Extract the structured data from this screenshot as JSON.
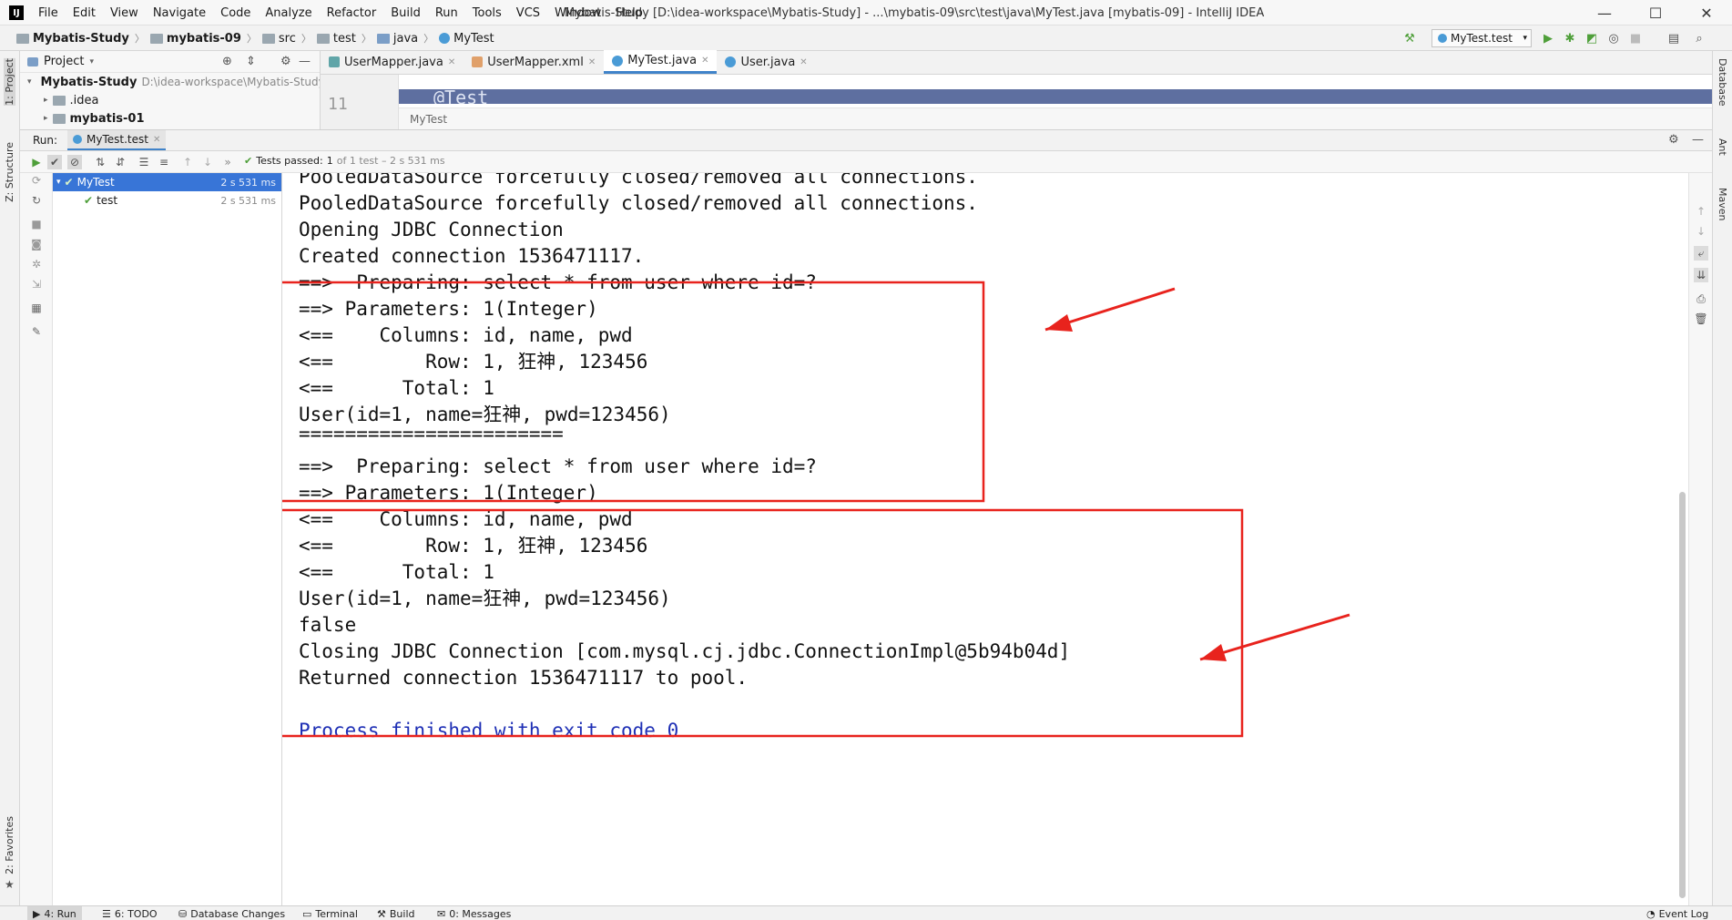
{
  "title_bar": {
    "app_icon": "IJ",
    "menu": [
      "File",
      "Edit",
      "View",
      "Navigate",
      "Code",
      "Analyze",
      "Refactor",
      "Build",
      "Run",
      "Tools",
      "VCS",
      "Window",
      "Help"
    ],
    "window_title": "Mybatis-Study [D:\\idea-workspace\\Mybatis-Study] - ...\\mybatis-09\\src\\test\\java\\MyTest.java [mybatis-09] - IntelliJ IDEA",
    "minimize": "—",
    "maximize": "☐",
    "close": "✕"
  },
  "navbar": {
    "crumbs": [
      "Mybatis-Study",
      "mybatis-09",
      "src",
      "test",
      "java",
      "MyTest"
    ],
    "run_config": "MyTest.test"
  },
  "left_stripe": {
    "project_label": "1: Project",
    "structure_label": "Z: Structure",
    "favorites_label": "2: Favorites"
  },
  "right_stripe": {
    "database_label": "Database",
    "ant_label": "Ant",
    "maven_label": "Maven"
  },
  "project_panel": {
    "title": "Project",
    "root": "Mybatis-Study",
    "root_path": "D:\\idea-workspace\\Mybatis-Study",
    "items": [
      ".idea",
      "mybatis-01"
    ]
  },
  "editor": {
    "tabs": [
      {
        "label": "UserMapper.java",
        "active": false
      },
      {
        "label": "UserMapper.xml",
        "active": false
      },
      {
        "label": "MyTest.java",
        "active": true
      },
      {
        "label": "User.java",
        "active": false
      }
    ],
    "line_number": "11",
    "code": "@Test",
    "breadcrumb": "MyTest"
  },
  "run_window": {
    "label": "Run:",
    "tab": "MyTest.test",
    "status": "Tests passed:",
    "status_count": "1",
    "status_detail": "of 1 test – 2 s 531 ms",
    "tree": [
      {
        "label": "MyTest",
        "time": "2 s 531 ms",
        "selected": true
      },
      {
        "label": "test",
        "time": "2 s 531 ms",
        "selected": false
      }
    ]
  },
  "console": {
    "lines": [
      "PooledDataSource forcefully closed/removed all connections.",
      "PooledDataSource forcefully closed/removed all connections.",
      "Opening JDBC Connection",
      "Created connection 1536471117.",
      "==>  Preparing: select * from user where id=?",
      "==> Parameters: 1(Integer)",
      "<==    Columns: id, name, pwd",
      "<==        Row: 1, 狂神, 123456",
      "<==      Total: 1",
      "User(id=1, name=狂神, pwd=123456)",
      "=======================",
      "==>  Preparing: select * from user where id=?",
      "==> Parameters: 1(Integer)",
      "<==    Columns: id, name, pwd",
      "<==        Row: 1, 狂神, 123456",
      "<==      Total: 1",
      "User(id=1, name=狂神, pwd=123456)",
      "false",
      "Closing JDBC Connection [com.mysql.cj.jdbc.ConnectionImpl@5b94b04d]",
      "Returned connection 1536471117 to pool.",
      "",
      "Process finished with exit code 0"
    ],
    "annotation_color": "#e8231d"
  },
  "statusbar": {
    "items": [
      {
        "icon": "▶",
        "label": "4: Run",
        "active": true
      },
      {
        "icon": "☰",
        "label": "6: TODO",
        "active": false
      },
      {
        "icon": "⛁",
        "label": "Database Changes",
        "active": false
      },
      {
        "icon": "▭",
        "label": "Terminal",
        "active": false
      },
      {
        "icon": "⚒",
        "label": "Build",
        "active": false
      },
      {
        "icon": "✉",
        "label": "0: Messages",
        "active": false
      }
    ],
    "event_log": "Event Log"
  }
}
